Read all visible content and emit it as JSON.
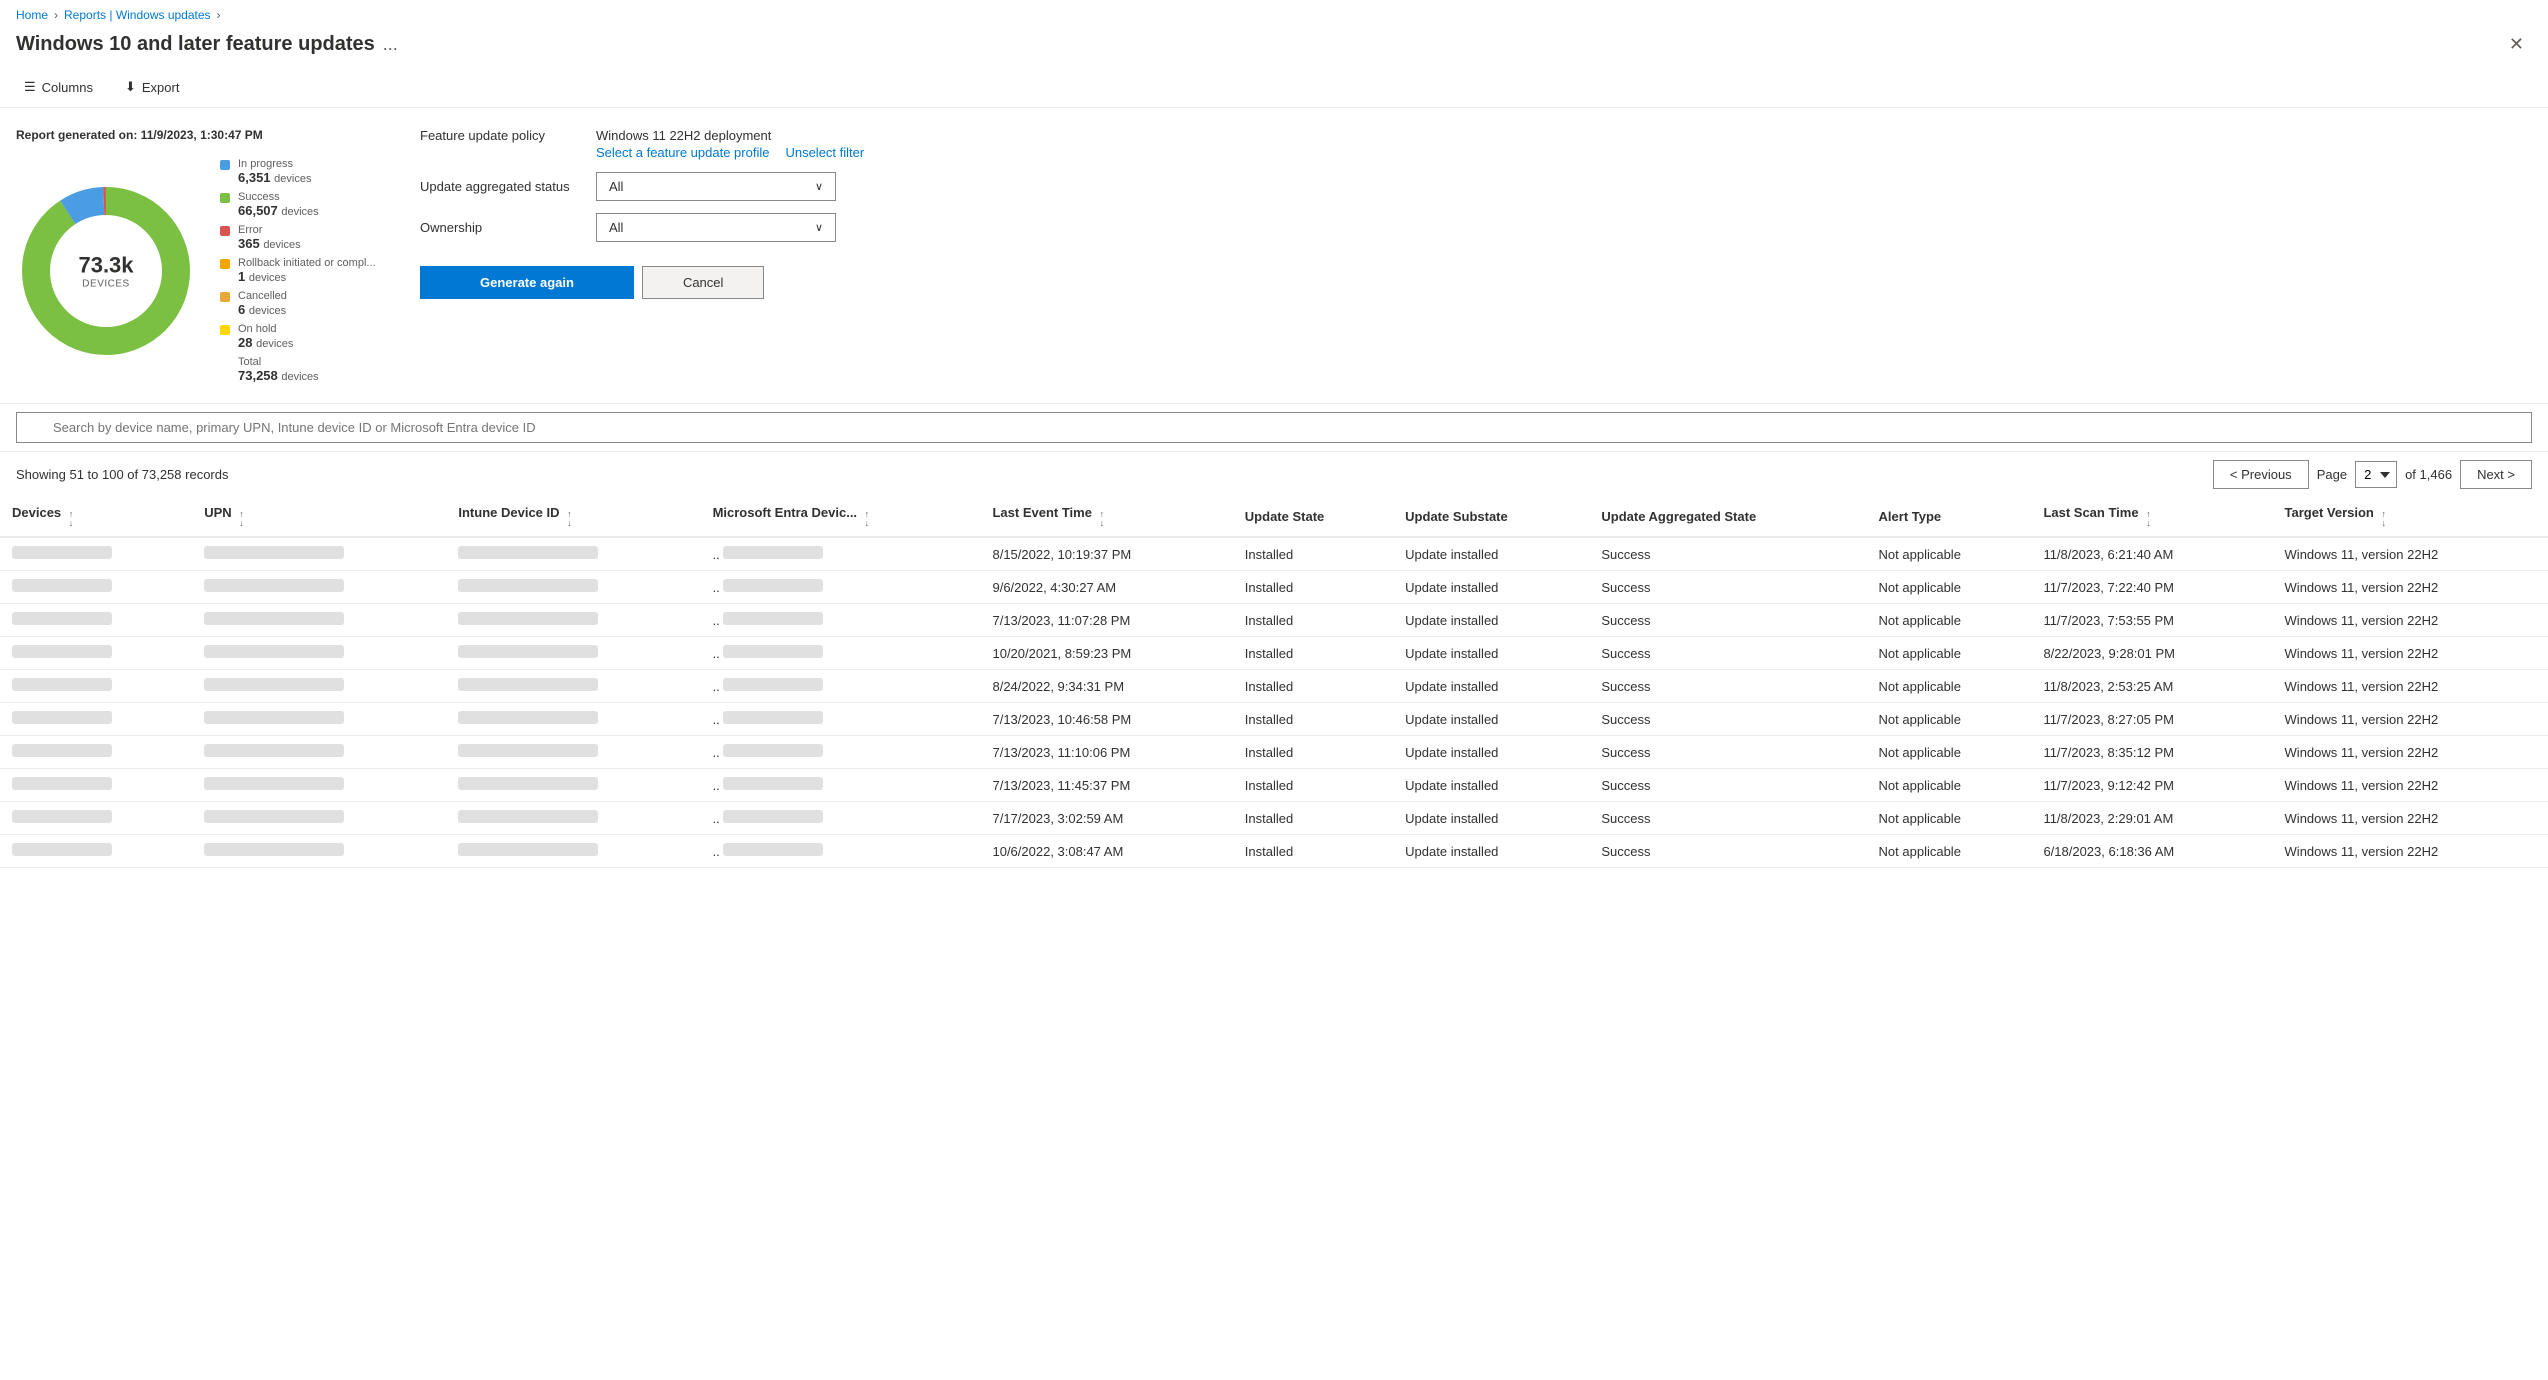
{
  "breadcrumb": {
    "home": "Home",
    "reports": "Reports | Windows updates"
  },
  "header": {
    "title": "Windows 10 and later feature updates",
    "more_icon": "...",
    "close_icon": "✕"
  },
  "toolbar": {
    "columns_label": "Columns",
    "export_label": "Export"
  },
  "report": {
    "generated_text": "Report generated on: 11/9/2023, 1:30:47 PM",
    "donut": {
      "center_number": "73.3k",
      "center_label": "DEVICES"
    },
    "legend": [
      {
        "color": "#4a9de2",
        "name": "In progress",
        "count": "6,351",
        "unit": "devices"
      },
      {
        "color": "#7bc043",
        "name": "Success",
        "count": "66,507",
        "unit": "devices"
      },
      {
        "color": "#d9534f",
        "name": "Error",
        "count": "365",
        "unit": "devices"
      },
      {
        "color": "#f0a500",
        "name": "Rollback initiated or compl...",
        "count": "1",
        "unit": "devices"
      },
      {
        "color": "#e8a838",
        "name": "Cancelled",
        "count": "6",
        "unit": "devices"
      },
      {
        "color": "#ffd600",
        "name": "On hold",
        "count": "28",
        "unit": "devices"
      }
    ],
    "total_label": "Total",
    "total_count": "73,258",
    "total_unit": "devices"
  },
  "filters": {
    "policy_label": "Feature update policy",
    "policy_name": "Windows 11 22H2 deployment",
    "select_profile_link": "Select a feature update profile",
    "unselect_filter_link": "Unselect filter",
    "aggregated_label": "Update aggregated status",
    "aggregated_value": "All",
    "ownership_label": "Ownership",
    "ownership_value": "All",
    "generate_btn": "Generate again",
    "cancel_btn": "Cancel"
  },
  "search": {
    "placeholder": "Search by device name, primary UPN, Intune device ID or Microsoft Entra device ID"
  },
  "table_controls": {
    "showing_text": "Showing 51 to 100 of 73,258 records",
    "page_label": "Page",
    "page_value": "2",
    "of_label": "of 1,466",
    "prev_btn": "< Previous",
    "next_btn": "Next >"
  },
  "table": {
    "columns": [
      "Devices",
      "UPN",
      "Intune Device ID",
      "Microsoft Entra Devic...",
      "Last Event Time",
      "Update State",
      "Update Substate",
      "Update Aggregated State",
      "Alert Type",
      "Last Scan Time",
      "Target Version"
    ],
    "rows": [
      {
        "last_event": "8/15/2022, 10:19:37 PM",
        "update_state": "Installed",
        "update_substate": "Update installed",
        "aggregated_state": "Success",
        "alert_type": "Not applicable",
        "last_scan": "11/8/2023, 6:21:40 AM",
        "target": "Windows 11, version 22H2"
      },
      {
        "last_event": "9/6/2022, 4:30:27 AM",
        "update_state": "Installed",
        "update_substate": "Update installed",
        "aggregated_state": "Success",
        "alert_type": "Not applicable",
        "last_scan": "11/7/2023, 7:22:40 PM",
        "target": "Windows 11, version 22H2"
      },
      {
        "last_event": "7/13/2023, 11:07:28 PM",
        "update_state": "Installed",
        "update_substate": "Update installed",
        "aggregated_state": "Success",
        "alert_type": "Not applicable",
        "last_scan": "11/7/2023, 7:53:55 PM",
        "target": "Windows 11, version 22H2"
      },
      {
        "last_event": "10/20/2021, 8:59:23 PM",
        "update_state": "Installed",
        "update_substate": "Update installed",
        "aggregated_state": "Success",
        "alert_type": "Not applicable",
        "last_scan": "8/22/2023, 9:28:01 PM",
        "target": "Windows 11, version 22H2"
      },
      {
        "last_event": "8/24/2022, 9:34:31 PM",
        "update_state": "Installed",
        "update_substate": "Update installed",
        "aggregated_state": "Success",
        "alert_type": "Not applicable",
        "last_scan": "11/8/2023, 2:53:25 AM",
        "target": "Windows 11, version 22H2"
      },
      {
        "last_event": "7/13/2023, 10:46:58 PM",
        "update_state": "Installed",
        "update_substate": "Update installed",
        "aggregated_state": "Success",
        "alert_type": "Not applicable",
        "last_scan": "11/7/2023, 8:27:05 PM",
        "target": "Windows 11, version 22H2"
      },
      {
        "last_event": "7/13/2023, 11:10:06 PM",
        "update_state": "Installed",
        "update_substate": "Update installed",
        "aggregated_state": "Success",
        "alert_type": "Not applicable",
        "last_scan": "11/7/2023, 8:35:12 PM",
        "target": "Windows 11, version 22H2"
      },
      {
        "last_event": "7/13/2023, 11:45:37 PM",
        "update_state": "Installed",
        "update_substate": "Update installed",
        "aggregated_state": "Success",
        "alert_type": "Not applicable",
        "last_scan": "11/7/2023, 9:12:42 PM",
        "target": "Windows 11, version 22H2"
      },
      {
        "last_event": "7/17/2023, 3:02:59 AM",
        "update_state": "Installed",
        "update_substate": "Update installed",
        "aggregated_state": "Success",
        "alert_type": "Not applicable",
        "last_scan": "11/8/2023, 2:29:01 AM",
        "target": "Windows 11, version 22H2"
      },
      {
        "last_event": "10/6/2022, 3:08:47 AM",
        "update_state": "Installed",
        "update_substate": "Update installed",
        "aggregated_state": "Success",
        "alert_type": "Not applicable",
        "last_scan": "6/18/2023, 6:18:36 AM",
        "target": "Windows 11, version 22H2"
      }
    ]
  },
  "colors": {
    "primary": "#0078d4",
    "border": "#edebe9"
  }
}
